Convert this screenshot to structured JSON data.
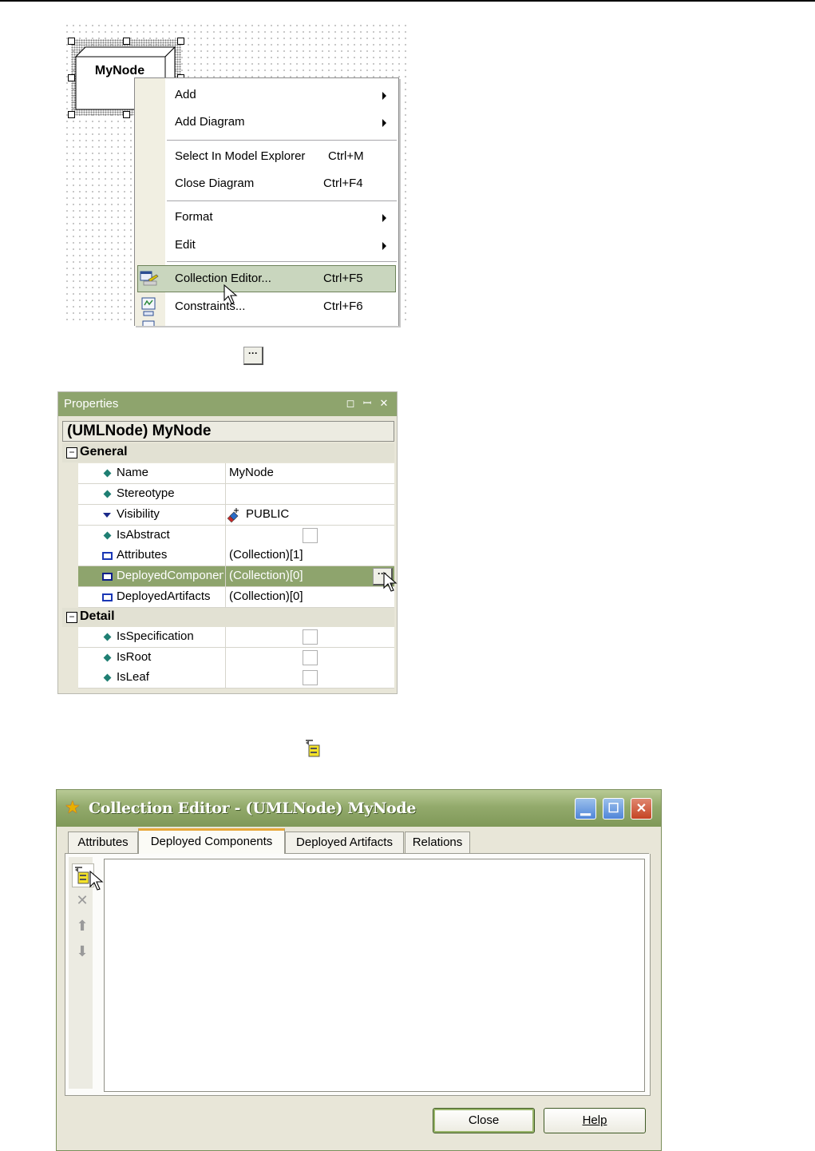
{
  "diagram": {
    "node_label": "MyNode"
  },
  "context_menu": {
    "items": [
      {
        "label": "Add",
        "shortcut": "",
        "submenu": true
      },
      {
        "label": "Add Diagram",
        "shortcut": "",
        "submenu": true
      },
      {
        "label": "Select In Model Explorer",
        "shortcut": "Ctrl+M",
        "submenu": false
      },
      {
        "label": "Close Diagram",
        "shortcut": "Ctrl+F4",
        "submenu": false
      },
      {
        "label": "Format",
        "shortcut": "",
        "submenu": true
      },
      {
        "label": "Edit",
        "shortcut": "",
        "submenu": true
      },
      {
        "label": "Collection Editor...",
        "shortcut": "Ctrl+F5",
        "submenu": false,
        "highlighted": true
      },
      {
        "label": "Constraints...",
        "shortcut": "Ctrl+F6",
        "submenu": false
      }
    ]
  },
  "ellipsis_button": {
    "label": "···"
  },
  "properties": {
    "title": "Properties",
    "header": "(UMLNode) MyNode",
    "categories": [
      {
        "name": "General",
        "rows": [
          {
            "name": "Name",
            "value": "MyNode"
          },
          {
            "name": "Stereotype",
            "value": ""
          },
          {
            "name": "Visibility",
            "value": "PUBLIC"
          },
          {
            "name": "IsAbstract",
            "value": ""
          },
          {
            "name": "Attributes",
            "value": "(Collection)[1]"
          },
          {
            "name": "DeployedComponents",
            "value": "(Collection)[0]",
            "selected": true
          },
          {
            "name": "DeployedArtifacts",
            "value": "(Collection)[0]"
          }
        ]
      },
      {
        "name": "Detail",
        "rows": [
          {
            "name": "IsSpecification",
            "value": ""
          },
          {
            "name": "IsRoot",
            "value": ""
          },
          {
            "name": "IsLeaf",
            "value": ""
          }
        ]
      }
    ]
  },
  "collection_editor": {
    "title": "Collection Editor - (UMLNode) MyNode",
    "tabs": [
      "Attributes",
      "Deployed Components",
      "Deployed Artifacts",
      "Relations"
    ],
    "active_tab": "Deployed Components",
    "buttons": {
      "close": "Close",
      "help": "Help"
    }
  },
  "icons": {
    "menu_collection_editor": "collection-editor-icon",
    "menu_constraints": "constraints-icon",
    "add_component": "add-component-icon",
    "delete": "delete-icon",
    "move_up": "arrow-up-icon",
    "move_down": "arrow-down-icon"
  },
  "colors": {
    "accent": "#8ea46d",
    "menu_highlight": "#c9d6be",
    "tab_active_top": "#e7a83a",
    "close_button": "#c44423",
    "window_button": "#4f85d8"
  }
}
